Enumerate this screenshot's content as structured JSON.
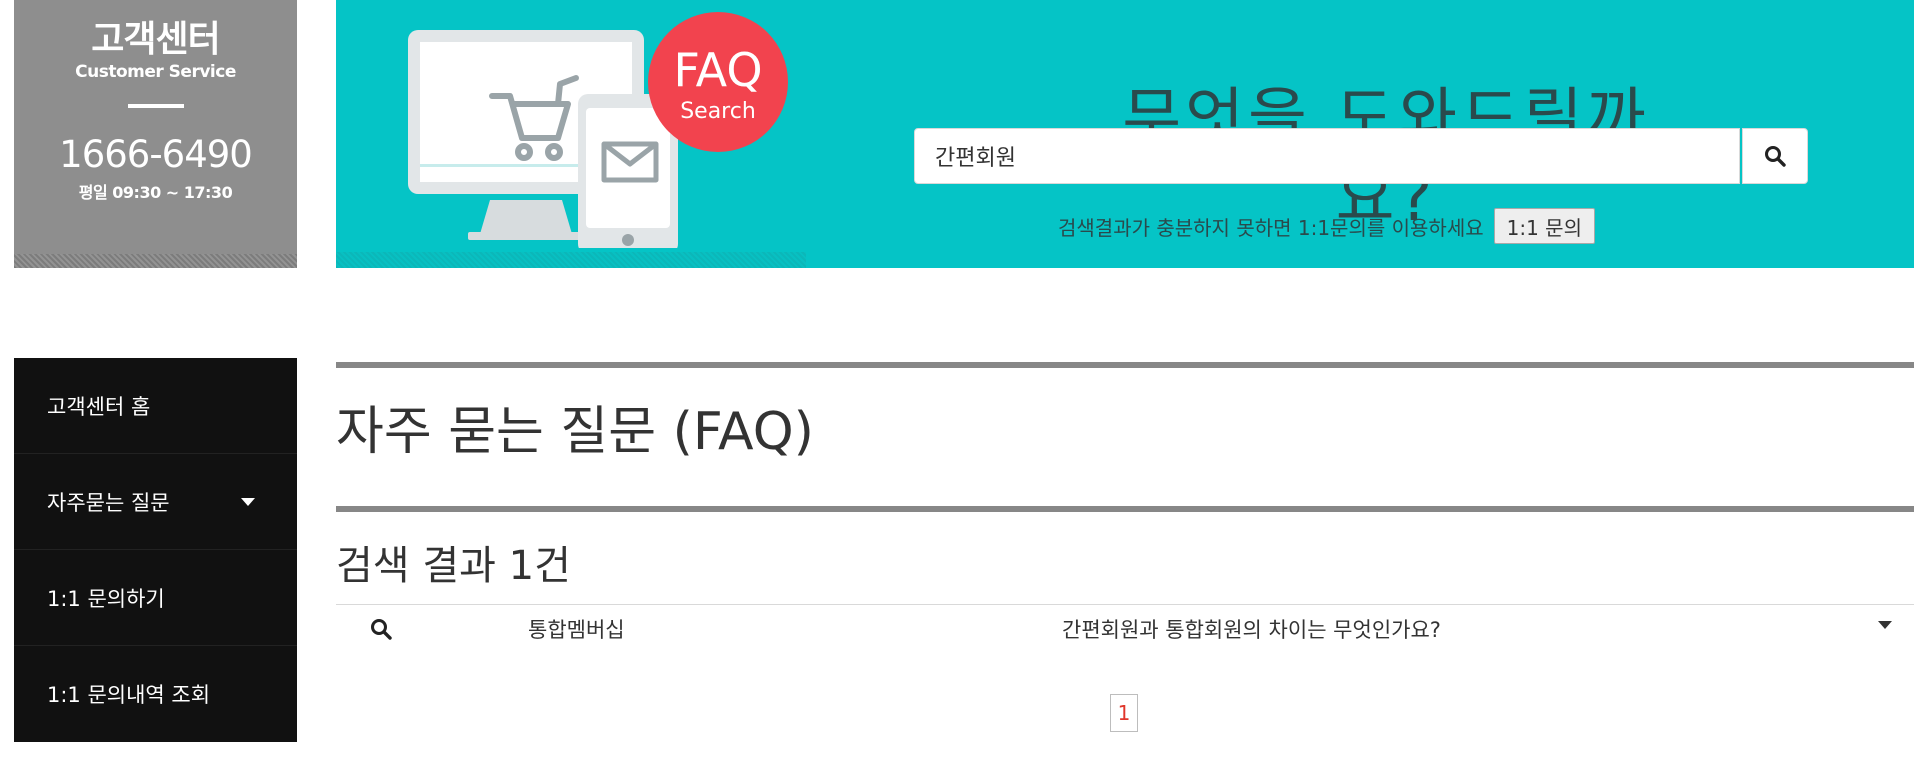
{
  "colors": {
    "banner_bg": "#05c4c6",
    "cs_box_bg": "#8e8e8e",
    "sidenav_bg": "#111111",
    "faq_badge": "#f2434e",
    "rule": "#878787",
    "active_page": "#e0362b"
  },
  "customer_service": {
    "title": "고객센터",
    "subtitle": "Customer Service",
    "phone": "1666-6490",
    "hours": "평일 09:30 ~ 17:30"
  },
  "banner": {
    "badge_title": "FAQ",
    "badge_sub": "Search",
    "heading": "무엇을 도와드릴까요?",
    "search_value": "간편회원",
    "search_icon": "search-icon",
    "hint": "검색결과가 충분하지 못하면 1:1문의를 이용하세요",
    "inquiry_button": "1:1 문의"
  },
  "sidebar": {
    "items": [
      {
        "label": "고객센터 홈"
      },
      {
        "label": "자주묻는 질문",
        "icon": "caret-down-icon"
      },
      {
        "label": "1:1 문의하기"
      },
      {
        "label": "1:1 문의내역 조회"
      }
    ]
  },
  "main": {
    "title": "자주 묻는 질문 (FAQ)",
    "result_count": "검색 결과 1건",
    "results": [
      {
        "icon": "search-icon",
        "category": "통합멤버십",
        "question": "간편회원과 통합회원의 차이는 무엇인가요?",
        "expand_icon": "caret-down-icon"
      }
    ],
    "pagination": {
      "current": "1"
    }
  }
}
